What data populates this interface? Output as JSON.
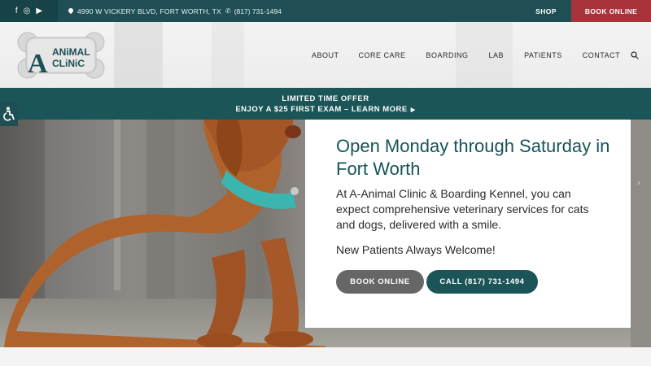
{
  "topbar": {
    "social": [
      {
        "icon": "facebook-icon",
        "glyph": "f"
      },
      {
        "icon": "instagram-icon",
        "glyph": "◎"
      },
      {
        "icon": "youtube-icon",
        "glyph": "▶"
      }
    ],
    "address": "4990 W VICKERY BLVD, FORT WORTH, TX",
    "phone": "(817) 731-1494",
    "shop_label": "SHOP",
    "book_label": "BOOK ONLINE",
    "colors": {
      "bar": "#1f4f55",
      "book": "#a8333a"
    }
  },
  "logo": {
    "text_line1": "ANiMAL",
    "text_line2": "CLiNiC",
    "letter": "A"
  },
  "nav": {
    "items": [
      "ABOUT",
      "CORE CARE",
      "BOARDING",
      "LAB",
      "PATIENTS",
      "CONTACT"
    ],
    "search_icon": "search-icon"
  },
  "promo": {
    "line1": "LIMITED TIME OFFER",
    "line2": "ENJOY A $25 FIRST EXAM – LEARN MORE",
    "arrow": "▶"
  },
  "hero": {
    "title": "Open Monday through Saturday in Fort Worth",
    "description": "At A-Animal Clinic & Boarding Kennel, you can expect comprehensive veterinary services for cats and dogs, delivered with a smile.",
    "welcome": "New Patients Always Welcome!",
    "book_button": "BOOK ONLINE",
    "call_button": "CALL (817) 731-1494",
    "next_arrow": "›",
    "colors": {
      "title": "#16545a",
      "call": "#1c5558",
      "book": "#666666"
    }
  }
}
